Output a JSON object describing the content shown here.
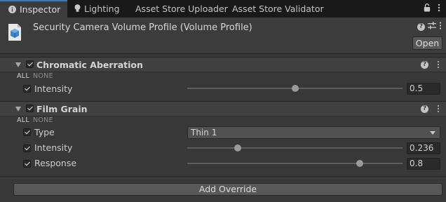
{
  "tabs": [
    {
      "label": "Inspector",
      "icon": "info-icon",
      "active": true
    },
    {
      "label": "Lighting",
      "icon": "lightbulb-icon",
      "active": false
    },
    {
      "label": "Asset Store Uploader",
      "active": false
    },
    {
      "label": "Asset Store Validator",
      "active": false
    }
  ],
  "header": {
    "title": "Security Camera Volume Profile (Volume Profile)",
    "open_label": "Open",
    "asset_icon": "volume-profile-icon"
  },
  "all_label": "ALL",
  "none_label": "NONE",
  "components": {
    "chromatic": {
      "title": "Chromatic Aberration",
      "enabled": true,
      "intensity": {
        "label": "Intensity",
        "value": "0.5",
        "slider_fraction": 0.5,
        "overridden": true
      }
    },
    "film_grain": {
      "title": "Film Grain",
      "enabled": true,
      "type": {
        "label": "Type",
        "value": "Thin 1",
        "overridden": true
      },
      "intensity": {
        "label": "Intensity",
        "value": "0.236",
        "slider_fraction": 0.236,
        "overridden": true
      },
      "response": {
        "label": "Response",
        "value": "0.8",
        "slider_fraction": 0.8,
        "overridden": true
      }
    }
  },
  "add_override_label": "Add Override",
  "colors": {
    "accent": "#3a79bb",
    "background": "#383838",
    "tab_bar": "#191919"
  }
}
